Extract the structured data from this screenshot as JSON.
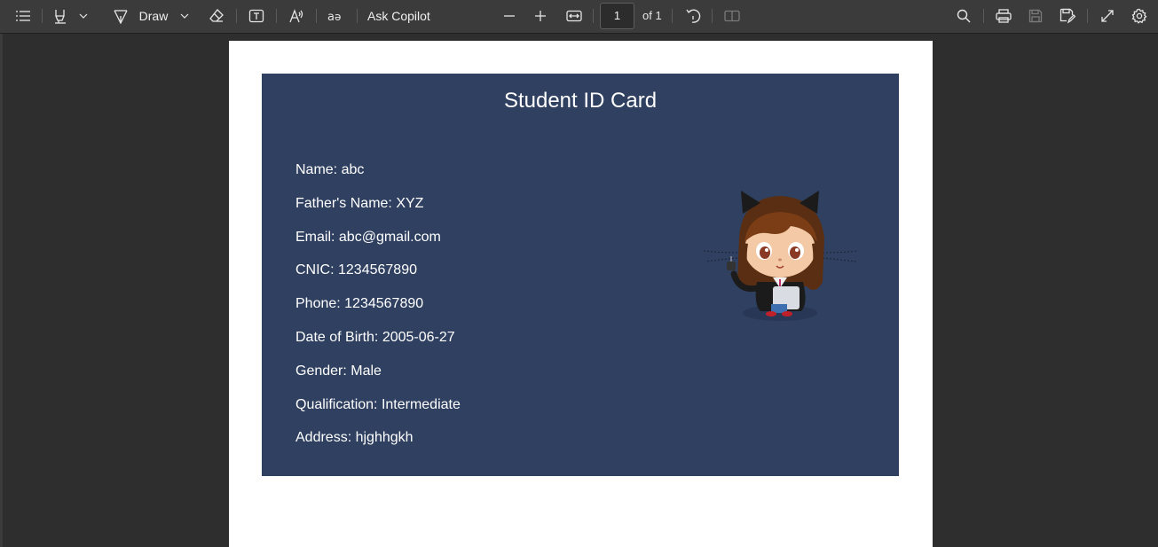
{
  "toolbar": {
    "draw_label": "Draw",
    "copilot_label": "Ask Copilot",
    "page_number": "1",
    "page_of": "of 1"
  },
  "card": {
    "title": "Student ID Card",
    "fields": [
      "Name: abc",
      "Father's Name: XYZ",
      "Email: abc@gmail.com",
      "CNIC: 1234567890",
      "Phone: 1234567890",
      "Date of Birth: 2005-06-27",
      "Gender: Male",
      "Qualification: Intermediate",
      "Address: hjghhgkh"
    ]
  },
  "colors": {
    "toolbar_bg": "#3b3b3b",
    "canvas_bg": "#2e2e2e",
    "card_bg": "#2f4060"
  }
}
